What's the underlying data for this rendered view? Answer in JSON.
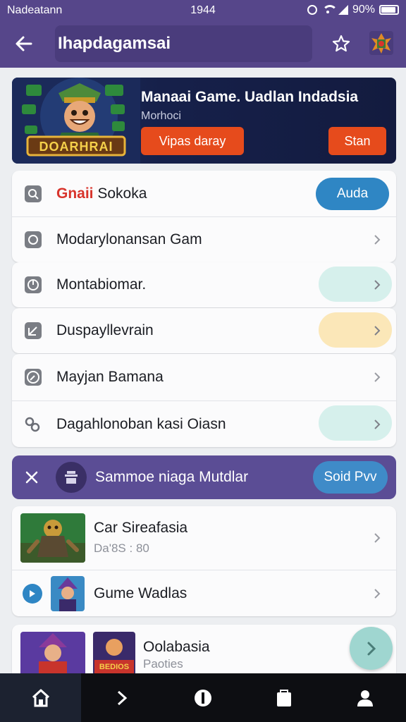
{
  "status": {
    "carrier": "Nadeatann",
    "time": "1944",
    "battery": "90%"
  },
  "appbar": {
    "title": "Ihapdagamsai"
  },
  "banner": {
    "title": "Manaai Game. Uadlan Indadsia",
    "subtitle": "Morhoci",
    "secondary_button": "Vipas daray",
    "start_button": "Stan",
    "art_text": "DOARHRAI"
  },
  "menu": {
    "first_row": {
      "label_prefix": "Gnaii",
      "label_rest": "Sokoka",
      "button": "Auda"
    },
    "rows": [
      {
        "label": "Modarylonansan Gam",
        "icon": "circle-icon",
        "pill": ""
      },
      {
        "label": "Montabiomar.",
        "icon": "monitor-icon",
        "pill": "#d6f0ec"
      },
      {
        "label": "Duspayllevrain",
        "icon": "edit-square-icon",
        "pill": "#fbe7b8"
      },
      {
        "label": "Mayjan Bamana",
        "icon": "compass-icon",
        "pill": ""
      },
      {
        "label": "Dagahlonoban kasi Oiasn",
        "icon": "link-icon",
        "pill": "#d6f0ec"
      }
    ]
  },
  "section": {
    "label": "Sammoe niaga Mutdlar",
    "button": "Soid Pvv"
  },
  "games": [
    {
      "title": "Car Sireafasia",
      "meta": "Da'8S : 80"
    },
    {
      "title": "Gume Wadlas",
      "meta": ""
    },
    {
      "title": "Oolabasia",
      "meta": "Paoties",
      "art_text": "BEDIOS"
    }
  ],
  "colors": {
    "header": "#56468a",
    "accent_orange": "#e64b1c",
    "accent_blue": "#2f86c4",
    "section": "#5b4d95"
  }
}
